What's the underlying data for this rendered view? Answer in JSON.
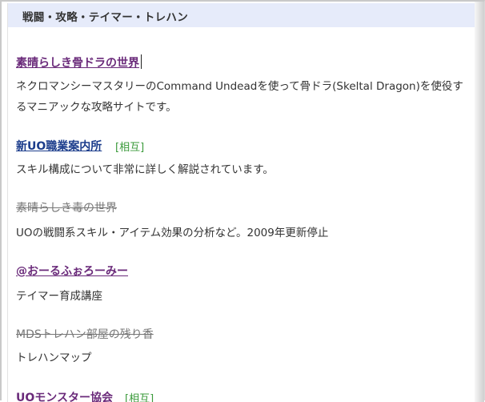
{
  "header": {
    "title": "戦闘・攻略・テイマー・トレハン"
  },
  "entries": [
    {
      "link": "素晴らしき骨ドラの世界",
      "description": "ネクロマンシーマスタリーのCommand Undeadを使って骨ドラ(Skeltal Dragon)を使役するマニアックな攻略サイトです。"
    },
    {
      "link": "新UO職業案内所",
      "badge": "[相互]",
      "description": "スキル構成について非常に詳しく解説されています。"
    },
    {
      "link": "素晴らしき毒の世界",
      "description": "UOの戦闘系スキル・アイテム効果の分析など。2009年更新停止"
    },
    {
      "link": "@おーるふぉろーみー",
      "description": "テイマー育成講座"
    },
    {
      "link": "MDSトレハン部屋の残り香",
      "description": "トレハンマップ"
    },
    {
      "link": "UOモンスター協会",
      "badge": "[相互]"
    }
  ],
  "colors": {
    "header_bg": "#e6ebfa",
    "visited_link": "#6a2a7a",
    "link": "#1c3d8c",
    "dead_link": "#777777",
    "badge": "#3a9a3a"
  }
}
